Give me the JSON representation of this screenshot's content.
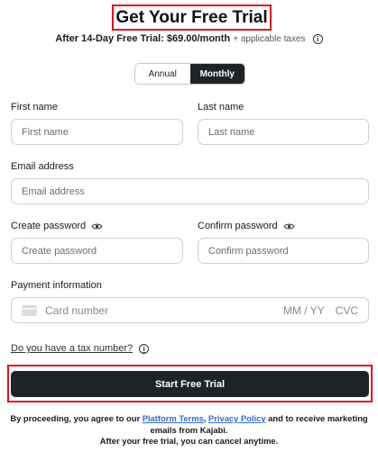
{
  "header": {
    "title": "Get Your Free Trial",
    "subtitle_main": "After 14-Day Free Trial: $69.00/month",
    "subtitle_taxes": "+ applicable taxes"
  },
  "billing_toggle": {
    "options": [
      "Annual",
      "Monthly"
    ],
    "selected": "Monthly"
  },
  "form": {
    "first_name": {
      "label": "First name",
      "placeholder": "First name",
      "value": ""
    },
    "last_name": {
      "label": "Last name",
      "placeholder": "Last name",
      "value": ""
    },
    "email": {
      "label": "Email address",
      "placeholder": "Email address",
      "value": ""
    },
    "create_password": {
      "label": "Create password",
      "placeholder": "Create password",
      "value": ""
    },
    "confirm_password": {
      "label": "Confirm password",
      "placeholder": "Confirm password",
      "value": ""
    },
    "payment": {
      "label": "Payment information",
      "card_placeholder": "Card number",
      "expiry_placeholder": "MM / YY",
      "cvc_placeholder": "CVC"
    }
  },
  "tax_link": "Do you have a tax number?",
  "submit_label": "Start Free Trial",
  "legal": {
    "prefix": "By proceeding, you agree to our ",
    "platform_terms": "Platform Terms",
    "comma": ",",
    "privacy_policy": "Privacy Policy",
    "suffix": " and to receive marketing",
    "line2": "emails from Kajabi.",
    "line3": "After your free trial, you can cancel anytime."
  },
  "colors": {
    "primary_button": "#1f2329",
    "link": "#2f6bdc",
    "highlight_outline": "#e3101b"
  }
}
